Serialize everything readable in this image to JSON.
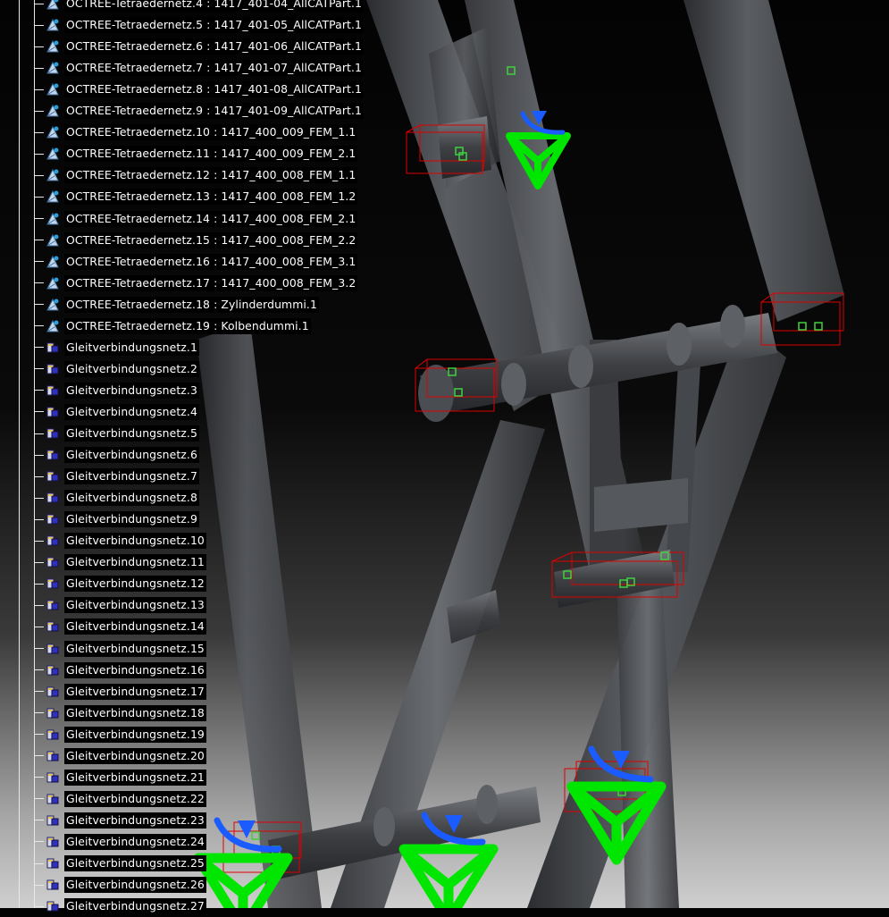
{
  "tree": {
    "octree_items": [
      {
        "label": "OCTREE-Tetraedernetz.4 : 1417_401-04_AllCATPart.1",
        "icon": "octree-mesh-icon"
      },
      {
        "label": "OCTREE-Tetraedernetz.5 : 1417_401-05_AllCATPart.1",
        "icon": "octree-mesh-icon"
      },
      {
        "label": "OCTREE-Tetraedernetz.6 : 1417_401-06_AllCATPart.1",
        "icon": "octree-mesh-icon"
      },
      {
        "label": "OCTREE-Tetraedernetz.7 : 1417_401-07_AllCATPart.1",
        "icon": "octree-mesh-icon"
      },
      {
        "label": "OCTREE-Tetraedernetz.8 : 1417_401-08_AllCATPart.1",
        "icon": "octree-mesh-icon"
      },
      {
        "label": "OCTREE-Tetraedernetz.9 : 1417_401-09_AllCATPart.1",
        "icon": "octree-mesh-icon"
      },
      {
        "label": "OCTREE-Tetraedernetz.10 : 1417_400_009_FEM_1.1",
        "icon": "octree-mesh-icon"
      },
      {
        "label": "OCTREE-Tetraedernetz.11 : 1417_400_009_FEM_2.1",
        "icon": "octree-mesh-icon"
      },
      {
        "label": "OCTREE-Tetraedernetz.12 : 1417_400_008_FEM_1.1",
        "icon": "octree-mesh-icon"
      },
      {
        "label": "OCTREE-Tetraedernetz.13 : 1417_400_008_FEM_1.2",
        "icon": "octree-mesh-icon"
      },
      {
        "label": "OCTREE-Tetraedernetz.14 : 1417_400_008_FEM_2.1",
        "icon": "octree-mesh-icon"
      },
      {
        "label": "OCTREE-Tetraedernetz.15 : 1417_400_008_FEM_2.2",
        "icon": "octree-mesh-icon"
      },
      {
        "label": "OCTREE-Tetraedernetz.16 : 1417_400_008_FEM_3.1",
        "icon": "octree-mesh-icon"
      },
      {
        "label": "OCTREE-Tetraedernetz.17 : 1417_400_008_FEM_3.2",
        "icon": "octree-mesh-icon"
      },
      {
        "label": "OCTREE-Tetraedernetz.18 : Zylinderdummi.1",
        "icon": "octree-mesh-icon"
      },
      {
        "label": "OCTREE-Tetraedernetz.19 : Kolbendummi.1",
        "icon": "octree-mesh-icon"
      }
    ],
    "glide_items": [
      {
        "label": "Gleitverbindungsnetz.1",
        "icon": "slider-connection-mesh-icon"
      },
      {
        "label": "Gleitverbindungsnetz.2",
        "icon": "slider-connection-mesh-icon"
      },
      {
        "label": "Gleitverbindungsnetz.3",
        "icon": "slider-connection-mesh-icon"
      },
      {
        "label": "Gleitverbindungsnetz.4",
        "icon": "slider-connection-mesh-icon"
      },
      {
        "label": "Gleitverbindungsnetz.5",
        "icon": "slider-connection-mesh-icon"
      },
      {
        "label": "Gleitverbindungsnetz.6",
        "icon": "slider-connection-mesh-icon"
      },
      {
        "label": "Gleitverbindungsnetz.7",
        "icon": "slider-connection-mesh-icon"
      },
      {
        "label": "Gleitverbindungsnetz.8",
        "icon": "slider-connection-mesh-icon"
      },
      {
        "label": "Gleitverbindungsnetz.9",
        "icon": "slider-connection-mesh-icon"
      },
      {
        "label": "Gleitverbindungsnetz.10",
        "icon": "slider-connection-mesh-icon"
      },
      {
        "label": "Gleitverbindungsnetz.11",
        "icon": "slider-connection-mesh-icon"
      },
      {
        "label": "Gleitverbindungsnetz.12",
        "icon": "slider-connection-mesh-icon"
      },
      {
        "label": "Gleitverbindungsnetz.13",
        "icon": "slider-connection-mesh-icon"
      },
      {
        "label": "Gleitverbindungsnetz.14",
        "icon": "slider-connection-mesh-icon"
      },
      {
        "label": "Gleitverbindungsnetz.15",
        "icon": "slider-connection-mesh-icon"
      },
      {
        "label": "Gleitverbindungsnetz.16",
        "icon": "slider-connection-mesh-icon"
      },
      {
        "label": "Gleitverbindungsnetz.17",
        "icon": "slider-connection-mesh-icon"
      },
      {
        "label": "Gleitverbindungsnetz.18",
        "icon": "slider-connection-mesh-icon"
      },
      {
        "label": "Gleitverbindungsnetz.19",
        "icon": "slider-connection-mesh-icon"
      },
      {
        "label": "Gleitverbindungsnetz.20",
        "icon": "slider-connection-mesh-icon"
      },
      {
        "label": "Gleitverbindungsnetz.21",
        "icon": "slider-connection-mesh-icon"
      },
      {
        "label": "Gleitverbindungsnetz.22",
        "icon": "slider-connection-mesh-icon"
      },
      {
        "label": "Gleitverbindungsnetz.23",
        "icon": "slider-connection-mesh-icon"
      },
      {
        "label": "Gleitverbindungsnetz.24",
        "icon": "slider-connection-mesh-icon"
      },
      {
        "label": "Gleitverbindungsnetz.25",
        "icon": "slider-connection-mesh-icon"
      },
      {
        "label": "Gleitverbindungsnetz.26",
        "icon": "slider-connection-mesh-icon"
      },
      {
        "label": "Gleitverbindungsnetz.27",
        "icon": "slider-connection-mesh-icon"
      }
    ]
  },
  "viewport": {
    "symbols": [
      "clamp-restraint-icon",
      "rotation-constraint-icon",
      "connection-box-icon",
      "node-marker-icon"
    ],
    "colors": {
      "restraint": "#00e600",
      "rotation": "#1a5cff",
      "connection": "#e00000",
      "marker": "#1f9a1f",
      "steel": "#4a4d52"
    }
  }
}
